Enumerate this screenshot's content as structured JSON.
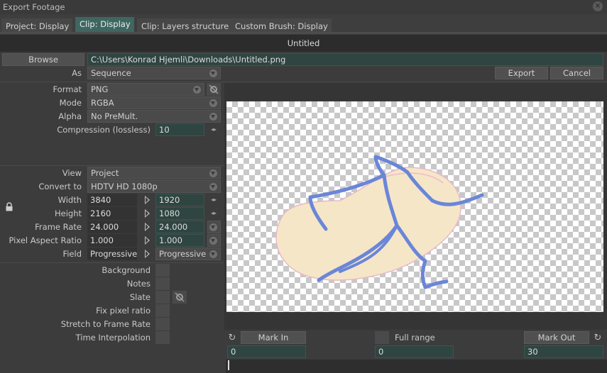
{
  "window": {
    "title": "Export Footage"
  },
  "tabs": [
    {
      "label": "Project: Display"
    },
    {
      "label": "Clip: Display"
    },
    {
      "label": "Clip: Layers structure"
    },
    {
      "label": "Custom Brush: Display"
    }
  ],
  "clip_title": "Untitled",
  "browse": {
    "label": "Browse",
    "path": "C:\\Users\\Konrad Hjemli\\Downloads\\Untitled.png"
  },
  "as": {
    "label": "As",
    "value": "Sequence"
  },
  "actions": {
    "export": "Export",
    "cancel": "Cancel"
  },
  "format": {
    "format_label": "Format",
    "format_value": "PNG",
    "mode_label": "Mode",
    "mode_value": "RGBA",
    "alpha_label": "Alpha",
    "alpha_value": "No PreMult.",
    "compression_label": "Compression (lossless)",
    "compression_value": "10"
  },
  "view": {
    "view_label": "View",
    "view_value": "Project",
    "convert_label": "Convert to",
    "convert_value": "HDTV  HD 1080p",
    "width_label": "Width",
    "width_src": "3840",
    "width_dst": "1920",
    "height_label": "Height",
    "height_src": "2160",
    "height_dst": "1080",
    "framerate_label": "Frame Rate",
    "framerate_src": "24.000",
    "framerate_dst": "24.000",
    "par_label": "Pixel Aspect Ratio",
    "par_src": "1.000",
    "par_dst": "1.000",
    "field_label": "Field",
    "field_src": "Progressive",
    "field_dst": "Progressive"
  },
  "options": [
    {
      "label": "Background"
    },
    {
      "label": "Notes"
    },
    {
      "label": "Slate"
    },
    {
      "label": "Fix pixel ratio"
    },
    {
      "label": "Stretch to Frame Rate"
    },
    {
      "label": "Time Interpolation"
    }
  ],
  "range": {
    "mark_in_label": "Mark In",
    "mark_in_value": "0",
    "full_range_label": "Full range",
    "full_range_value": "0",
    "mark_out_label": "Mark Out",
    "mark_out_value": "30"
  },
  "colors": {
    "accent": "#3f6660",
    "field_bg": "#2f4541",
    "stroke": "#6a86d8",
    "blob": "#f5e6c8"
  }
}
